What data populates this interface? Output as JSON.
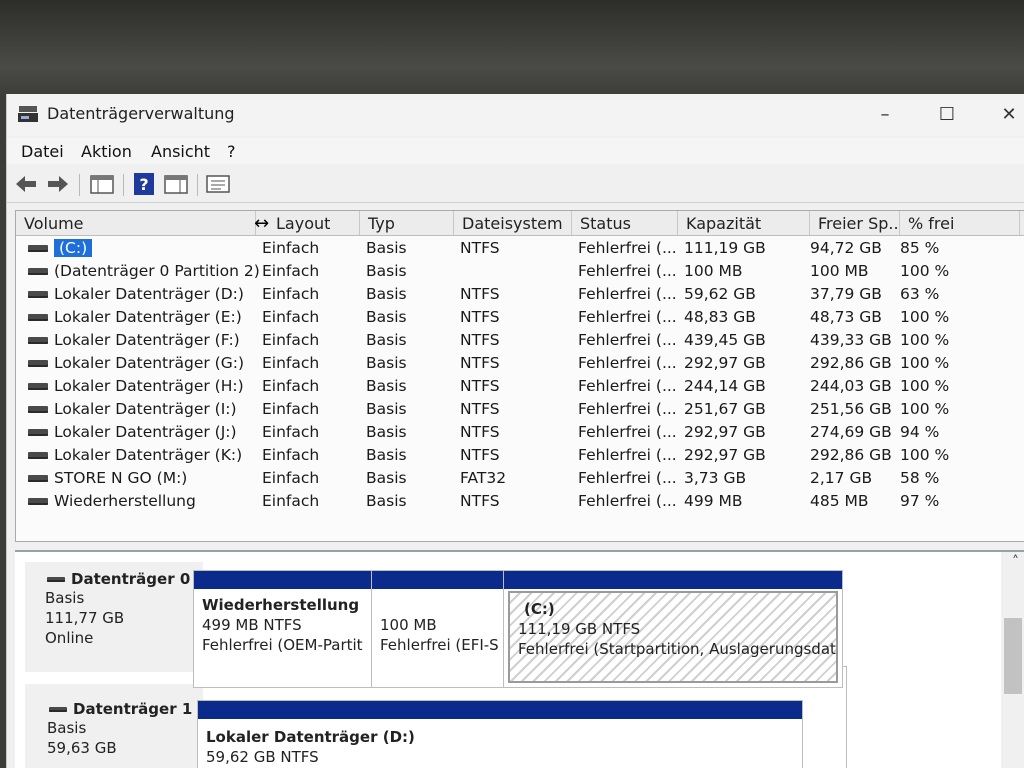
{
  "window": {
    "title": "Datenträgerverwaltung"
  },
  "window_controls": {
    "minimize": "–",
    "maximize": "☐",
    "close": "✕"
  },
  "menu": [
    "Datei",
    "Aktion",
    "Ansicht",
    "?"
  ],
  "toolbar_icons": [
    "back-arrow-icon",
    "forward-arrow-icon",
    "console-tree-icon",
    "help-icon",
    "show-hide-icon",
    "properties-icon"
  ],
  "columns": [
    "Volume",
    "Layout",
    "Typ",
    "Dateisystem",
    "Status",
    "Kapazität",
    "Freier Sp...",
    "% frei"
  ],
  "volumes": [
    {
      "name": "(C:)",
      "layout": "Einfach",
      "type": "Basis",
      "fs": "NTFS",
      "status": "Fehlerfrei (...",
      "capacity": "111,19 GB",
      "free": "94,72 GB",
      "pct": "85 %",
      "selected": true
    },
    {
      "name": "(Datenträger 0 Partition 2)",
      "layout": "Einfach",
      "type": "Basis",
      "fs": "",
      "status": "Fehlerfrei (...",
      "capacity": "100 MB",
      "free": "100 MB",
      "pct": "100 %"
    },
    {
      "name": "Lokaler Datenträger (D:)",
      "layout": "Einfach",
      "type": "Basis",
      "fs": "NTFS",
      "status": "Fehlerfrei (...",
      "capacity": "59,62 GB",
      "free": "37,79 GB",
      "pct": "63 %"
    },
    {
      "name": "Lokaler Datenträger (E:)",
      "layout": "Einfach",
      "type": "Basis",
      "fs": "NTFS",
      "status": "Fehlerfrei (...",
      "capacity": "48,83 GB",
      "free": "48,73 GB",
      "pct": "100 %"
    },
    {
      "name": "Lokaler Datenträger (F:)",
      "layout": "Einfach",
      "type": "Basis",
      "fs": "NTFS",
      "status": "Fehlerfrei (...",
      "capacity": "439,45 GB",
      "free": "439,33 GB",
      "pct": "100 %"
    },
    {
      "name": "Lokaler Datenträger (G:)",
      "layout": "Einfach",
      "type": "Basis",
      "fs": "NTFS",
      "status": "Fehlerfrei (...",
      "capacity": "292,97 GB",
      "free": "292,86 GB",
      "pct": "100 %"
    },
    {
      "name": "Lokaler Datenträger (H:)",
      "layout": "Einfach",
      "type": "Basis",
      "fs": "NTFS",
      "status": "Fehlerfrei (...",
      "capacity": "244,14 GB",
      "free": "244,03 GB",
      "pct": "100 %"
    },
    {
      "name": "Lokaler Datenträger (I:)",
      "layout": "Einfach",
      "type": "Basis",
      "fs": "NTFS",
      "status": "Fehlerfrei (...",
      "capacity": "251,67 GB",
      "free": "251,56 GB",
      "pct": "100 %"
    },
    {
      "name": "Lokaler Datenträger (J:)",
      "layout": "Einfach",
      "type": "Basis",
      "fs": "NTFS",
      "status": "Fehlerfrei (...",
      "capacity": "292,97 GB",
      "free": "274,69 GB",
      "pct": "94 %"
    },
    {
      "name": "Lokaler Datenträger (K:)",
      "layout": "Einfach",
      "type": "Basis",
      "fs": "NTFS",
      "status": "Fehlerfrei (...",
      "capacity": "292,97 GB",
      "free": "292,86 GB",
      "pct": "100 %"
    },
    {
      "name": "STORE N GO (M:)",
      "layout": "Einfach",
      "type": "Basis",
      "fs": "FAT32",
      "status": "Fehlerfrei (...",
      "capacity": "3,73 GB",
      "free": "2,17 GB",
      "pct": "58 %"
    },
    {
      "name": "Wiederherstellung",
      "layout": "Einfach",
      "type": "Basis",
      "fs": "NTFS",
      "status": "Fehlerfrei (...",
      "capacity": "499 MB",
      "free": "485 MB",
      "pct": "97 %"
    }
  ],
  "disks": [
    {
      "name": "Datenträger 0",
      "type": "Basis",
      "size": "111,77 GB",
      "state": "Online",
      "partitions": [
        {
          "title": "Wiederherstellung",
          "line1": "499 MB NTFS",
          "line2": "Fehlerfrei (OEM-Partit"
        },
        {
          "title": "",
          "line1": "100 MB",
          "line2": "Fehlerfrei (EFI-S"
        },
        {
          "title": "(C:)",
          "line1": "111,19 GB NTFS",
          "line2": "Fehlerfrei (Startpartition, Auslagerungsdatei,"
        }
      ]
    },
    {
      "name": "Datenträger 1",
      "type": "Basis",
      "size": "59,63 GB",
      "partitions": [
        {
          "title": "Lokaler Datenträger  (D:)",
          "line1": "59,62 GB NTFS"
        }
      ]
    }
  ],
  "colors": {
    "partition_bar": "#0a2a8c",
    "selection": "#1e6fd9"
  }
}
